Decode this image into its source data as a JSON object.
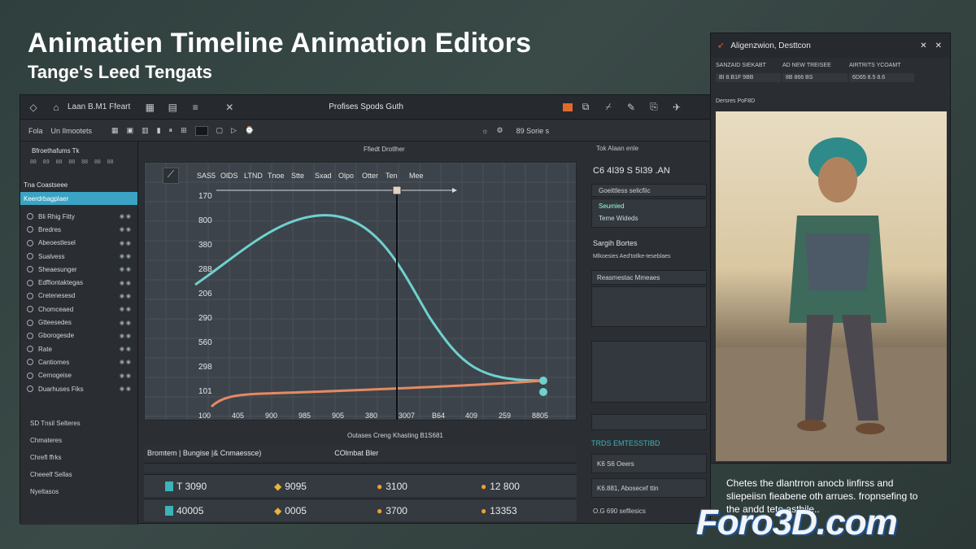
{
  "headline": "Animatien Timeline Animation Editors",
  "subhead": "Tange's Leed Tengats",
  "editor": {
    "title_left": "Laan B.M1 Ffeart",
    "title_center": "Profises Spods Guth",
    "toolbar": {
      "left": "Fola",
      "left2": "Un Ilmootets",
      "right": "89 Sorie s"
    },
    "sidebar_header": "Bfroethafums Tk",
    "sidebar_row2": "Tna Coastseee",
    "sidebar_selected": "Keerdrbagplaer",
    "sidebar_items": [
      "Bli Rhig Fitty",
      "Bredres",
      "Abeoestlesel",
      "Sualvess",
      "Sheaesunger",
      "Edffiontaktegas",
      "Cretenesesd",
      "Chomceaed",
      "Gtteesedes",
      "Gborogesde",
      "Rate",
      "Cantiomes",
      "Cernogeise",
      "Duarhuses Fiks"
    ],
    "sidebar_footer": [
      "SD Tnsil Selteres",
      "Chmateres",
      "Chrefl ffrks",
      "Cheeelf Sellas",
      "Nyeltasos"
    ],
    "graph_top_labels": [
      "SAS5",
      "OlDS",
      "LTND",
      "Tnoe",
      "Stte",
      "Sxad",
      "Olpo",
      "Otter",
      "Ten",
      "Mee"
    ],
    "graph_subheader": "Ffiedt Drotlher",
    "y_labels": [
      "170",
      "800",
      "380",
      "288",
      "206",
      "290",
      "560",
      "298",
      "101"
    ],
    "x_labels": [
      "100",
      "405",
      "900",
      "985",
      "905",
      "380",
      "3007",
      "B64",
      "409",
      "259",
      "8805"
    ],
    "x_caption": "Outases Creng Khasting B1S681",
    "bottom_header_left": "Bromtem | Bungise |& Cnmaessce)",
    "bottom_header_right": "COlmbat Bler",
    "rows": [
      {
        "c1": "T 3090",
        "c2": "9095",
        "c3": "3100",
        "c4": "12 800"
      },
      {
        "c1": "40005",
        "c2": "0005",
        "c3": "3700",
        "c4": "13353"
      }
    ]
  },
  "right_panel": {
    "top": "Tok Alaan enle",
    "value": "C6 4I39 S 5I39 .AN",
    "sec1": "Goeittless selicfiic",
    "sec1_items": [
      "Seumied",
      "Teme Wideds"
    ],
    "sec2": "Sargih Bortes",
    "sec2_sub": "Mlkoesies Aed'totlke-teseblaes",
    "sec3": "Reasmestac Mmeaes",
    "sec4": "TRDS EMTESSTIBD",
    "sec4_items": [
      "K6 S6 Oeers",
      "K6.881, Abosecef ttin",
      "O.G 690 sefllesics"
    ]
  },
  "char_window": {
    "title": "Aligenzwion, Desttcon",
    "cols": [
      "SANZAID SIEKABT",
      "AD NEW TREISEE",
      "AIRTRITS YCOAMT"
    ],
    "vals": [
      "BI 8.B1F 9BB",
      "8B 866 BS",
      "6D65 8.5 8.6"
    ],
    "img_label": "Dersres PoF8D"
  },
  "caption": "Chetes the dlantrron anocb linfirss and sliepeiisn fieabene oth arrues. fropnsefing to the andd tete asthile..",
  "logo": "Foro3D.com",
  "colors": {
    "accent": "#3bb3b8",
    "curve_cyan": "#6fd1cf",
    "curve_orange": "#e58a63"
  }
}
